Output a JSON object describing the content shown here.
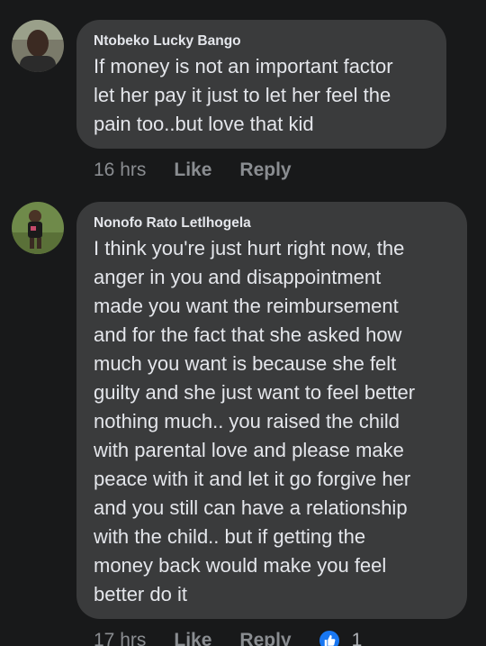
{
  "comments": [
    {
      "author": "Ntobeko Lucky Bango",
      "text_lines": [
        "If money is not an important factor",
        "let her pay it  just to let her feel the",
        "pain too..but love that kid"
      ],
      "time": "16 hrs",
      "like_label": "Like",
      "reply_label": "Reply"
    },
    {
      "author": "Nonofo Rato Letlhogela",
      "text_lines": [
        "I think you're just hurt right now, the",
        "anger in you and disappointment",
        "made you want the reimbursement",
        "and for the fact that she asked how",
        "much you want is because she felt",
        "guilty and she just want to feel better",
        "nothing much.. you raised the child",
        "with parental love and please make",
        "peace with it and let it go forgive her",
        "and you still can have a relationship",
        "with the child.. but if getting the",
        "money back would make you feel",
        "better do it"
      ],
      "time": "17 hrs",
      "like_label": "Like",
      "reply_label": "Reply",
      "reaction_count": "1",
      "reaction_icon": "thumbs-up-icon"
    }
  ],
  "colors": {
    "background": "#18191a",
    "bubble": "#3a3b3c",
    "text": "#e4e6eb",
    "meta": "#8a8d91",
    "like_blue": "#1877f2"
  }
}
